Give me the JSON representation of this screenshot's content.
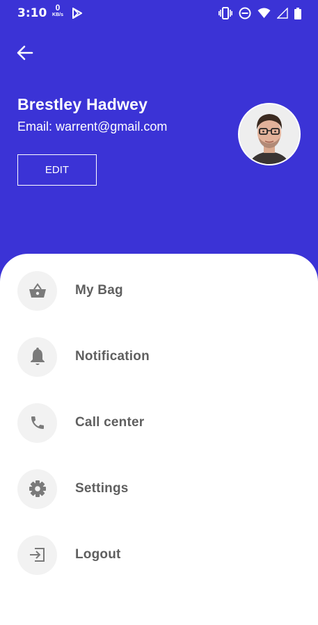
{
  "status_bar": {
    "time": "3:10",
    "net_speed": "0",
    "net_unit": "KB/s"
  },
  "profile": {
    "name": "Brestley Hadwey",
    "email": "Email: warrent@gmail.com",
    "edit_label": "EDIT"
  },
  "menu": {
    "items": [
      {
        "label": "My Bag",
        "icon": "basket-icon"
      },
      {
        "label": "Notification",
        "icon": "bell-icon"
      },
      {
        "label": "Call center",
        "icon": "phone-icon"
      },
      {
        "label": "Settings",
        "icon": "gear-icon"
      },
      {
        "label": "Logout",
        "icon": "logout-icon"
      }
    ]
  },
  "colors": {
    "header_bg": "#3b33d6",
    "panel_bg": "#ffffff",
    "icon_circle": "#f2f2f2",
    "icon_color": "#7a7a7a",
    "label_color": "#5f5f5f"
  }
}
